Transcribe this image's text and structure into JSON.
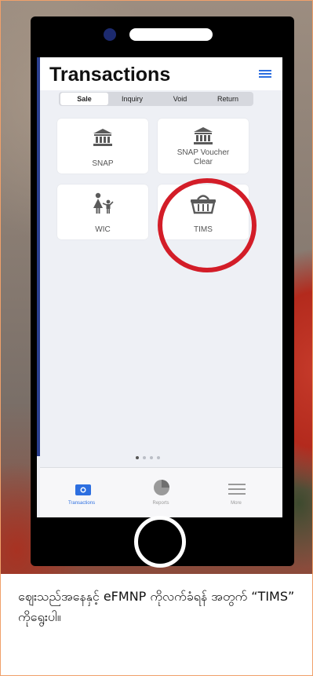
{
  "header": {
    "title": "Transactions"
  },
  "segments": [
    {
      "label": "Sale",
      "active": true
    },
    {
      "label": "Inquiry",
      "active": false
    },
    {
      "label": "Void",
      "active": false
    },
    {
      "label": "Return",
      "active": false
    }
  ],
  "tiles": [
    {
      "label": "SNAP",
      "icon": "bank-icon"
    },
    {
      "label": "SNAP Voucher Clear",
      "icon": "bank-icon"
    },
    {
      "label": "WIC",
      "icon": "mother-child-icon"
    },
    {
      "label": "TIMS",
      "icon": "basket-icon",
      "highlighted": true
    }
  ],
  "page_indicator": {
    "count": 4,
    "active_index": 0
  },
  "tabbar": {
    "items": [
      {
        "label": "Transactions",
        "icon": "card-icon",
        "active": true
      },
      {
        "label": "Reports",
        "icon": "pie-chart-icon",
        "active": false
      },
      {
        "label": "More",
        "icon": "menu-icon",
        "active": false
      }
    ]
  },
  "caption": "ဈေးသည်အနေနှင့် eFMNP ကိုလက်ခံရန် အတွက် “TIMS” ကိုရွေးပါ။",
  "colors": {
    "accent": "#2d6fe0",
    "highlight": "#d31d28",
    "brand_bar": "#2a3f8f"
  }
}
